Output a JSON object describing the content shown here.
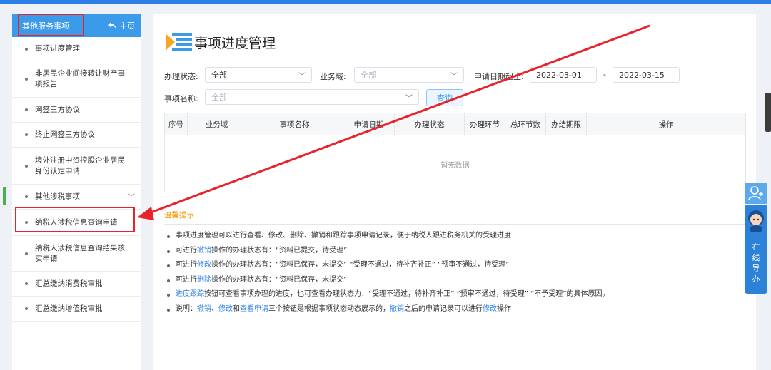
{
  "sidebar": {
    "header_title": "其他服务事项",
    "home_label": "主页",
    "items": [
      {
        "label": "事项进度管理"
      },
      {
        "label": "非居民企业间接转让财产事项报告"
      },
      {
        "label": "网签三方协议"
      },
      {
        "label": "终止网签三方协议"
      },
      {
        "label": "境外注册中资控股企业居民身份认定申请"
      },
      {
        "label": "其他涉税事项"
      },
      {
        "label": "纳税人涉税信息查询申请"
      },
      {
        "label": "纳税人涉税信息查询结果核实申请"
      },
      {
        "label": "汇总缴纳消费税审批"
      },
      {
        "label": "汇总缴纳增值税审批"
      }
    ]
  },
  "main": {
    "title": "事项进度管理",
    "filters": {
      "status_label": "办理状态:",
      "status_value": "全部",
      "domain_label": "业务域:",
      "domain_placeholder": "全部",
      "date_label": "申请日期起止:",
      "date_start": "2022-03-01",
      "date_sep": "-",
      "date_end": "2022-03-15",
      "name_label": "事项名称:",
      "name_placeholder": "全部",
      "query_button": "查询"
    },
    "table": {
      "headers": [
        "序号",
        "业务域",
        "事项名称",
        "申请日期",
        "办理状态",
        "办理环节",
        "总环节数",
        "办结期限",
        "操作"
      ],
      "empty_text": "暂无数据"
    },
    "tips": {
      "title": "温馨提示",
      "line1": "事项进度管理可以进行查看、修改、删除、撤销和跟踪事项申请记录，便于纳税人跟进税务机关的受理进度",
      "line2_pre": "可进行",
      "line2_link": "撤销",
      "line2_post": "操作的办理状态有：“资料已提交，待受理”",
      "line3_pre": "可进行",
      "line3_link": "修改",
      "line3_post": "操作的办理状态有：“资料已保存，未提交” “受理不通过，待补齐补正” “预审不通过，待受理”",
      "line4_pre": "可进行",
      "line4_link": "删除",
      "line4_post": "操作的办理状态有：“资料已保存，未提交”",
      "line5_link": "进度跟踪",
      "line5_post": "按钮可查看事项办理的进度，也可查看办理状态为：“受理不通过，待补齐补正” “预审不通过，待受理” “不予受理”的具体原因。",
      "line6_pre": "说明：",
      "line6_link1": "撤销",
      "line6_sep1": "、",
      "line6_link2": "修改",
      "line6_sep2": "和",
      "line6_link3": "查看申请",
      "line6_mid": "三个按钮是根据事项状态动态展示的，",
      "line6_link4": "撤销",
      "line6_mid2": "之后的申请记录可以进行",
      "line6_link5": "修改",
      "line6_post": "操作"
    }
  },
  "online_guide": {
    "label": "在线导办"
  },
  "colors": {
    "accent": "#3c9be8",
    "annotation_red": "#e8232b",
    "tip_title": "#f39800",
    "link": "#2c7fe6"
  }
}
